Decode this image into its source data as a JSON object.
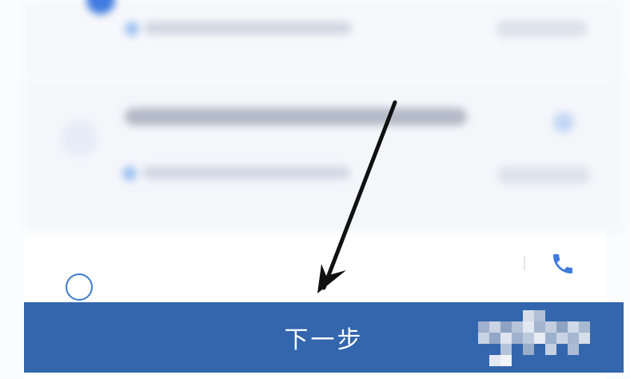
{
  "footer": {
    "next_label": "下一步"
  },
  "colors": {
    "accent": "#3366ad",
    "radio": "#3d7bd0",
    "phone": "#3f7be0"
  },
  "icons": {
    "phone": "phone-icon",
    "radio": "radio-circle-icon",
    "annotation": "arrow-annotation-icon"
  }
}
